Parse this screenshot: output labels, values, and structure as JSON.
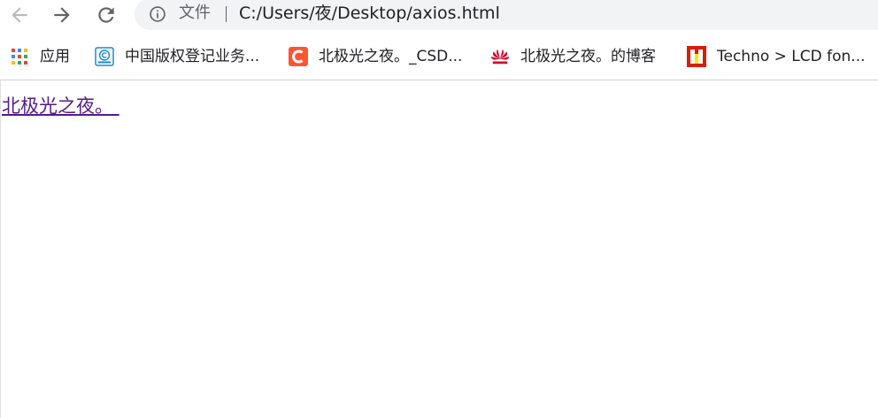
{
  "browser": {
    "omnibox": {
      "scheme_label": "文件",
      "url": "C:/Users/夜/Desktop/axios.html",
      "info_icon": "info-circle-icon"
    },
    "nav": {
      "back_icon": "arrow-left-icon",
      "forward_icon": "arrow-right-icon",
      "reload_icon": "reload-icon"
    },
    "bookmarks": [
      {
        "label": "应用",
        "icon": "apps-grid-icon"
      },
      {
        "label": "中国版权登记业务...",
        "icon": "copyright-icon"
      },
      {
        "label": "北极光之夜。_CSD...",
        "icon": "csdn-icon"
      },
      {
        "label": "北极光之夜。的博客",
        "icon": "huawei-icon"
      },
      {
        "label": "Techno > LCD fon...",
        "icon": "techno-icon"
      }
    ]
  },
  "page": {
    "link_text": "北极光之夜。 ",
    "link_color": "#551a8b"
  },
  "colors": {
    "omnibox_bg": "#f1f3f4",
    "csdn_red": "#fc5531",
    "huawei_red": "#cf0a2c",
    "copyright_blue": "#1a8ad4"
  }
}
